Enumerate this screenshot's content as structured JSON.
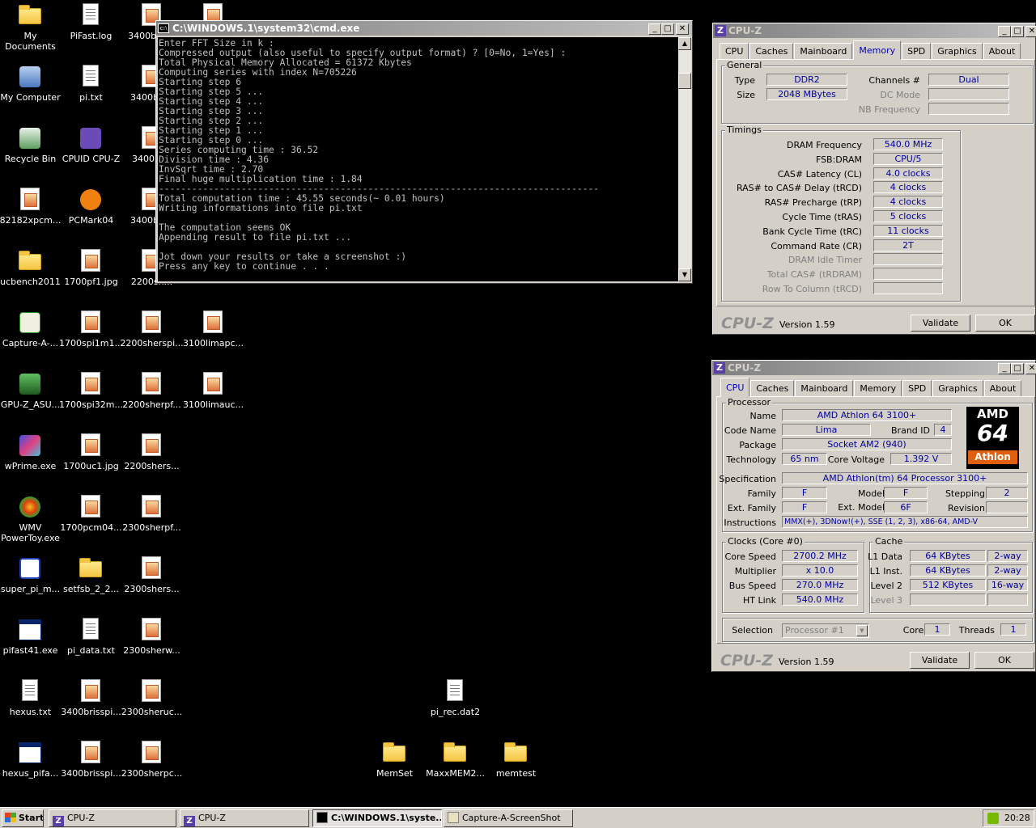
{
  "desktop": {
    "icons": [
      {
        "label": "My Documents",
        "kind": "folder"
      },
      {
        "label": "PiFast.log",
        "kind": "doc"
      },
      {
        "label": "3400bris...",
        "kind": "jpg"
      },
      {
        "label": "",
        "kind": "jpg"
      },
      {
        "label": "My Computer",
        "kind": "computer"
      },
      {
        "label": "pi.txt",
        "kind": "doc"
      },
      {
        "label": "3400bri...",
        "kind": "jpg"
      },
      {
        "label": "Recycle Bin",
        "kind": "recycle"
      },
      {
        "label": "CPUID CPU-Z",
        "kind": "cpuz"
      },
      {
        "label": "3400br...",
        "kind": "jpg"
      },
      {
        "label": "82182xpcm...",
        "kind": "jpg"
      },
      {
        "label": "PCMark04",
        "kind": "pcmark"
      },
      {
        "label": "3400bri...",
        "kind": "jpg"
      },
      {
        "label": "ucbench2011",
        "kind": "folder"
      },
      {
        "label": "1700pf1.jpg",
        "kind": "jpg"
      },
      {
        "label": "2200sh...",
        "kind": "jpg"
      },
      {
        "label": "Capture-A-...",
        "kind": "capture"
      },
      {
        "label": "1700spi1m1...",
        "kind": "jpg"
      },
      {
        "label": "2200sherspi...",
        "kind": "jpg"
      },
      {
        "label": "3100limapc...",
        "kind": "jpg"
      },
      {
        "label": "GPU-Z_ASU...",
        "kind": "gpuz"
      },
      {
        "label": "1700spi32m...",
        "kind": "jpg"
      },
      {
        "label": "2200sherpf...",
        "kind": "jpg"
      },
      {
        "label": "3100limauc...",
        "kind": "jpg"
      },
      {
        "label": "wPrime.exe",
        "kind": "wprime"
      },
      {
        "label": "1700uc1.jpg",
        "kind": "jpg"
      },
      {
        "label": "2200shers...",
        "kind": "jpg"
      },
      {
        "label": "WMV\nPowerToy.exe",
        "kind": "wmv"
      },
      {
        "label": "1700pcm04...",
        "kind": "jpg"
      },
      {
        "label": "2300sherpf...",
        "kind": "jpg"
      },
      {
        "label": "super_pi_m...",
        "kind": "superpi"
      },
      {
        "label": "setfsb_2_2...",
        "kind": "folder"
      },
      {
        "label": "2300shers...",
        "kind": "jpg"
      },
      {
        "label": "pifast41.exe",
        "kind": "exe"
      },
      {
        "label": "pi_data.txt",
        "kind": "doc"
      },
      {
        "label": "2300sherw...",
        "kind": "jpg"
      },
      {
        "label": "hexus.txt",
        "kind": "doc"
      },
      {
        "label": "3400brisspi...",
        "kind": "jpg"
      },
      {
        "label": "2300sheruc...",
        "kind": "jpg"
      },
      {
        "label": "pi_rec.dat2",
        "kind": "dat"
      },
      {
        "label": "hexus_pifa...",
        "kind": "exe2"
      },
      {
        "label": "3400brisspi...",
        "kind": "jpg"
      },
      {
        "label": "2300sherpc...",
        "kind": "jpg"
      },
      {
        "label": "MemSet",
        "kind": "folder"
      },
      {
        "label": "MaxxMEM2...",
        "kind": "folder"
      },
      {
        "label": "memtest",
        "kind": "folder"
      }
    ]
  },
  "cmd": {
    "title": "C:\\WINDOWS.1\\system32\\cmd.exe",
    "lines": "Enter FFT Size in k :\nCompressed output (also useful to specify output format) ? [0=No, 1=Yes] :\nTotal Physical Memory Allocated = 61372 Kbytes\nComputing series with index N=705226\nStarting step 6\nStarting step 5 ...\nStarting step 4 ...\nStarting step 3 ...\nStarting step 2 ...\nStarting step 1 ...\nStarting step 0 ...\nSeries computing time : 36.52\nDivision time : 4.36\nInvSqrt time : 2.70\nFinal huge multiplication time : 1.84\n--------------------------------------------------------------------------------\nTotal computation time : 45.55 seconds(~ 0.01 hours)\nWriting informations into file pi.txt\n\nThe computation seems OK\nAppending result to file pi.txt ...\n\nJot down your results or take a screenshot :)\nPress any key to continue . . ."
  },
  "cpuz_common": {
    "title": "CPU-Z",
    "tabs": [
      "CPU",
      "Caches",
      "Mainboard",
      "Memory",
      "SPD",
      "Graphics",
      "About"
    ],
    "brand": "CPU-Z",
    "version": "Version 1.59",
    "validate": "Validate",
    "ok": "OK"
  },
  "memory": {
    "general_title": "General",
    "type_label": "Type",
    "type": "DDR2",
    "size_label": "Size",
    "size": "2048 MBytes",
    "channels_label": "Channels #",
    "channels": "Dual",
    "dcmode_label": "DC Mode",
    "dcmode": "",
    "nbfreq_label": "NB Frequency",
    "nbfreq": "",
    "timings_title": "Timings",
    "timings": [
      {
        "label": "DRAM Frequency",
        "value": "540.0 MHz",
        "dim": false
      },
      {
        "label": "FSB:DRAM",
        "value": "CPU/5",
        "dim": false
      },
      {
        "label": "CAS# Latency (CL)",
        "value": "4.0 clocks",
        "dim": false
      },
      {
        "label": "RAS# to CAS# Delay (tRCD)",
        "value": "4 clocks",
        "dim": false
      },
      {
        "label": "RAS# Precharge (tRP)",
        "value": "4 clocks",
        "dim": false
      },
      {
        "label": "Cycle Time (tRAS)",
        "value": "5 clocks",
        "dim": false
      },
      {
        "label": "Bank Cycle Time (tRC)",
        "value": "11 clocks",
        "dim": false
      },
      {
        "label": "Command Rate (CR)",
        "value": "2T",
        "dim": false
      },
      {
        "label": "DRAM Idle Timer",
        "value": "",
        "dim": true
      },
      {
        "label": "Total CAS# (tRDRAM)",
        "value": "",
        "dim": true
      },
      {
        "label": "Row To Column (tRCD)",
        "value": "",
        "dim": true
      }
    ]
  },
  "cpu": {
    "processor_title": "Processor",
    "name_label": "Name",
    "name": "AMD Athlon 64 3100+",
    "codename_label": "Code Name",
    "codename": "Lima",
    "brandid_label": "Brand ID",
    "brandid": "4",
    "package_label": "Package",
    "package": "Socket AM2 (940)",
    "tech_label": "Technology",
    "tech": "65 nm",
    "voltage_label": "Core Voltage",
    "voltage": "1.392 V",
    "spec_label": "Specification",
    "spec": "AMD Athlon(tm) 64 Processor 3100+",
    "family_label": "Family",
    "family": "F",
    "model_label": "Model",
    "model": "F",
    "stepping_label": "Stepping",
    "stepping": "2",
    "extfamily_label": "Ext. Family",
    "extfamily": "F",
    "extmodel_label": "Ext. Model",
    "extmodel": "6F",
    "revision_label": "Revision",
    "revision": "",
    "instr_label": "Instructions",
    "instr": "MMX(+), 3DNow!(+), SSE (1, 2, 3), x86-64, AMD-V",
    "logo_top": "AMD",
    "logo_num": "64",
    "logo_bottom": "Athlon",
    "clocks_title": "Clocks (Core #0)",
    "corespeed_label": "Core Speed",
    "corespeed": "2700.2 MHz",
    "multiplier_label": "Multiplier",
    "multiplier": "x 10.0",
    "busspeed_label": "Bus Speed",
    "busspeed": "270.0 MHz",
    "htlink_label": "HT Link",
    "htlink": "540.0 MHz",
    "cache_title": "Cache",
    "l1d_label": "L1 Data",
    "l1d": "64 KBytes",
    "l1d_way": "2-way",
    "l1i_label": "L1 Inst.",
    "l1i": "64 KBytes",
    "l1i_way": "2-way",
    "l2_label": "Level 2",
    "l2": "512 KBytes",
    "l2_way": "16-way",
    "l3_label": "Level 3",
    "l3": "",
    "l3_way": "",
    "selection_label": "Selection",
    "selection": "Processor #1",
    "cores_label": "Cores",
    "cores": "1",
    "threads_label": "Threads",
    "threads": "1"
  },
  "taskbar": {
    "start": "Start",
    "items": [
      "CPU-Z",
      "CPU-Z",
      "C:\\WINDOWS.1\\syste...",
      "Capture-A-ScreenShot"
    ],
    "clock": "20:28"
  }
}
